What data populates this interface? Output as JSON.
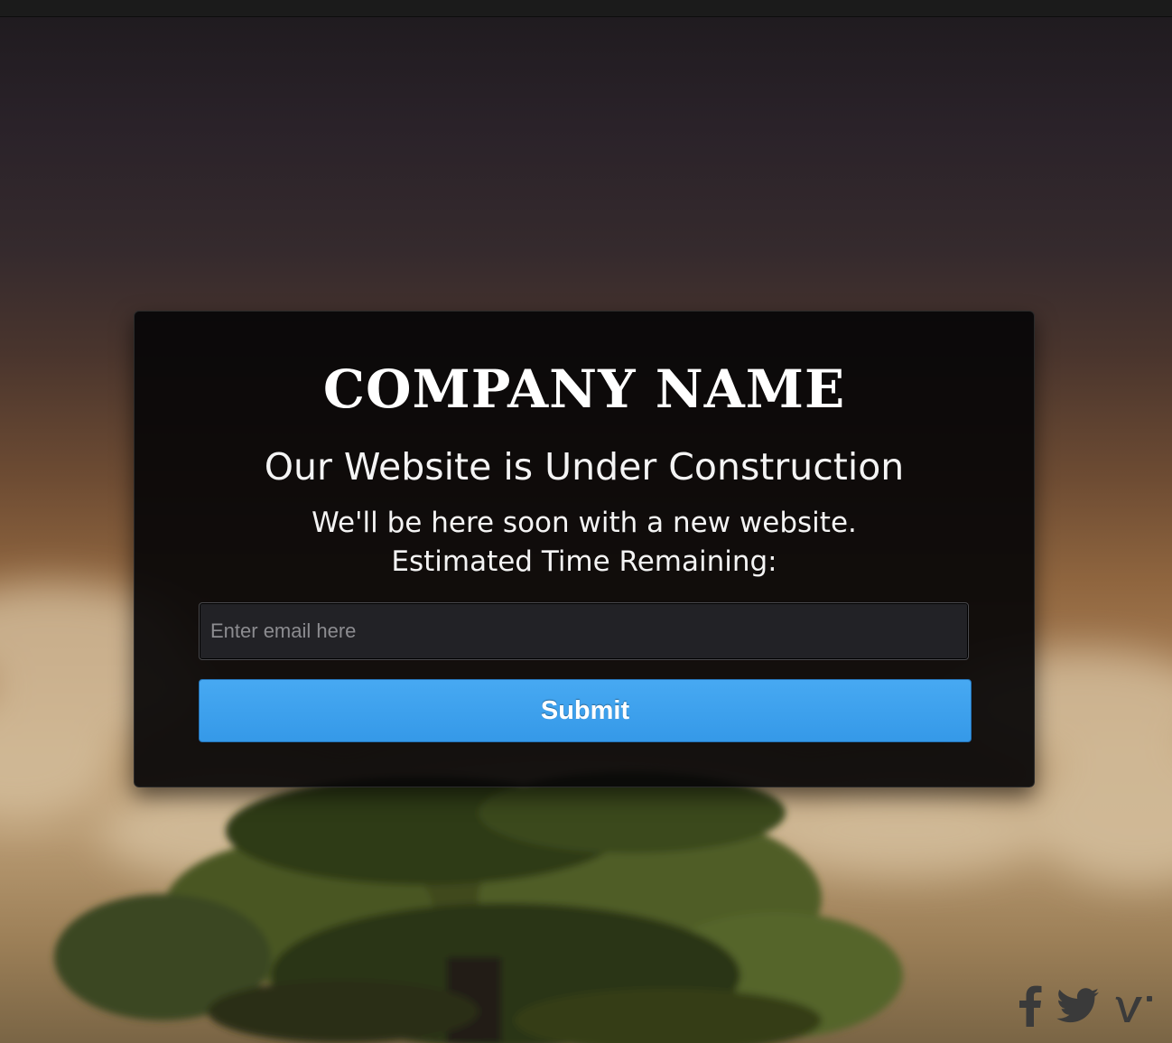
{
  "page": {
    "company_name": "COMPANY NAME",
    "headline": "Our Website is Under Construction",
    "subline": "We'll be here soon with a new website.",
    "timer_label": "Estimated Time Remaining:"
  },
  "form": {
    "email_placeholder": "Enter email here",
    "submit_label": "Submit"
  },
  "social": {
    "icons": [
      "facebook-icon",
      "twitter-icon",
      "vimeo-icon"
    ],
    "icon_color": "#3a3a3a"
  },
  "colors": {
    "panel_bg": "#080607",
    "button_bg": "#3a9eea",
    "text": "#ffffff"
  }
}
